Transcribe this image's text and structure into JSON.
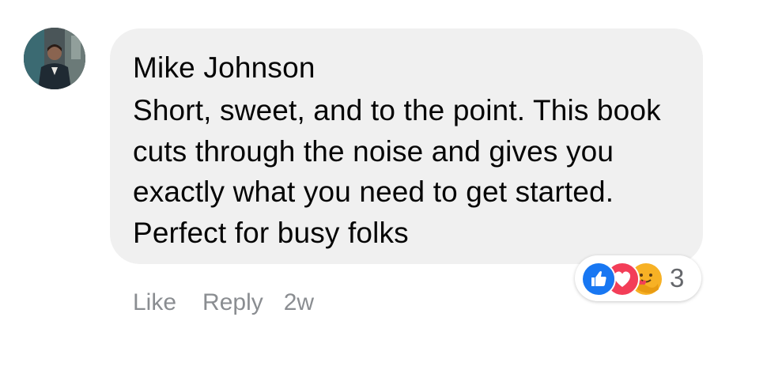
{
  "comment": {
    "author": "Mike Johnson",
    "text": "Short, sweet, and to the point. This book cuts through the noise and gives you exactly what you need to get started. Perfect for busy folks"
  },
  "reactions": {
    "icons": [
      "like-reaction-icon",
      "love-reaction-icon",
      "care-reaction-icon"
    ],
    "count": "3",
    "colors": {
      "like": "#1877f2",
      "love": "#f33e58",
      "care": "#f7b125"
    }
  },
  "actions": {
    "like_label": "Like",
    "reply_label": "Reply",
    "timestamp": "2w"
  },
  "colors": {
    "bubble": "#f0f0f0",
    "text": "#050505",
    "meta": "#8a8d91"
  }
}
